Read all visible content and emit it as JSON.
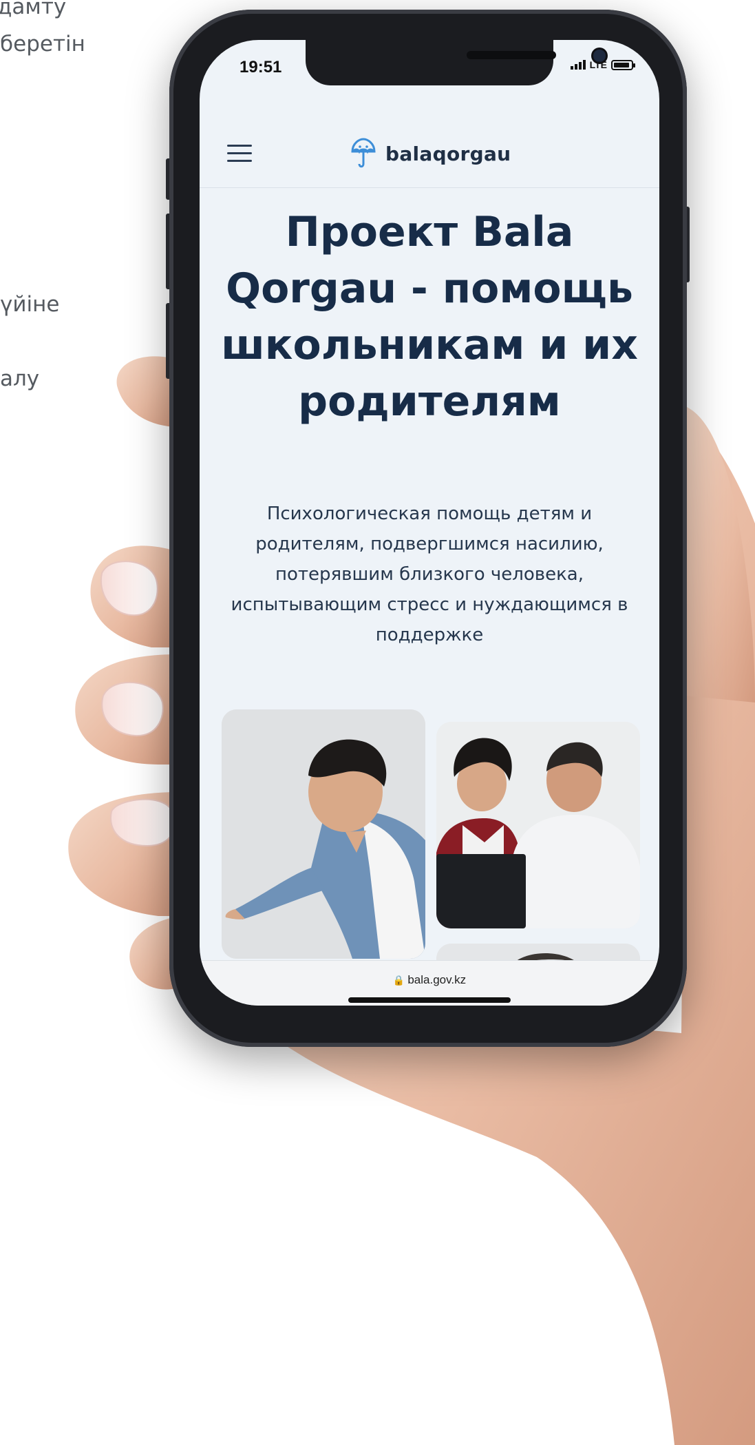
{
  "background_text": {
    "line1": "дамту",
    "line2": "беретін",
    "line3": "үйіне",
    "line4": "алу"
  },
  "status_bar": {
    "time": "19:51",
    "network": "LTE"
  },
  "header": {
    "logo_text": "balaqorgau"
  },
  "hero": {
    "title": "Проект Bala Qorgau - помощь школьникам и их родителям",
    "subtitle": "Психологическая помощь детям и родителям, подвергшимся насилию, потерявшим близкого человека, испытывающим стресс и нуждающимся в поддержке"
  },
  "browser": {
    "url": "bala.gov.kz"
  },
  "colors": {
    "title": "#172c48",
    "logo_accent": "#3d8ed8",
    "screen_bg": "#eef3f8"
  }
}
